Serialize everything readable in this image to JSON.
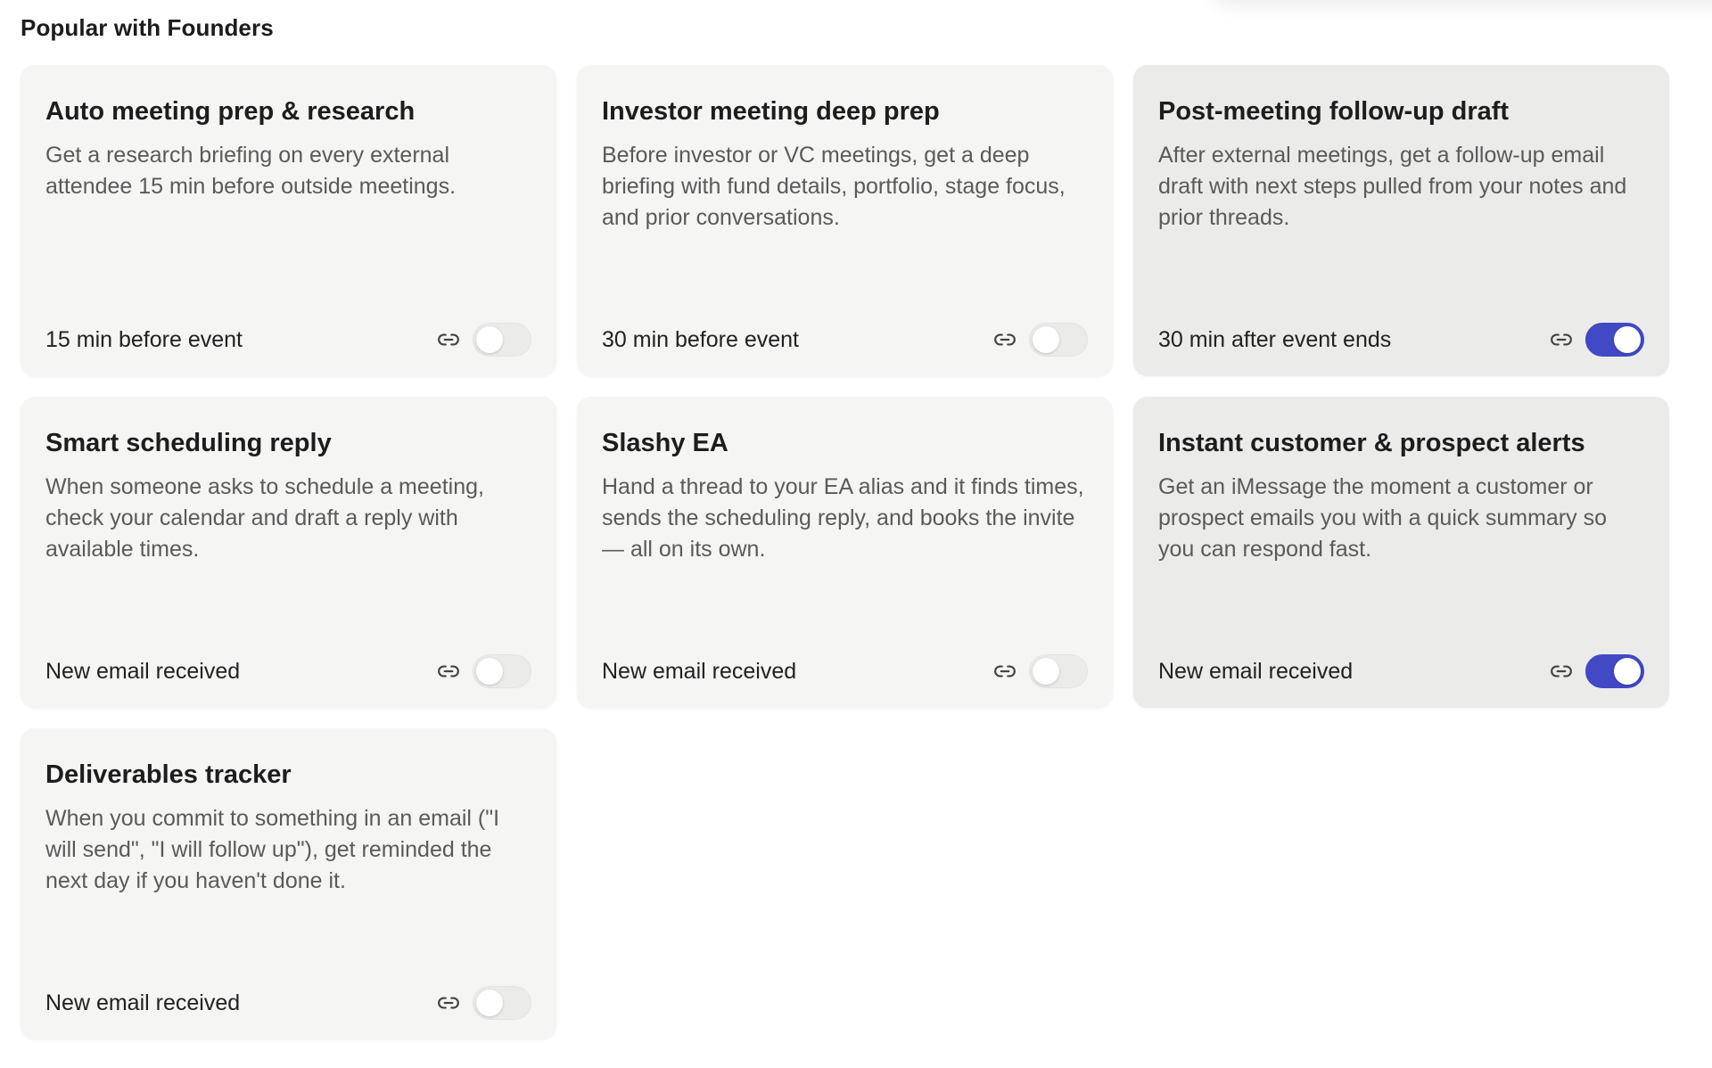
{
  "section": {
    "title": "Popular with Founders"
  },
  "colors": {
    "toggle_on": "#4149c4",
    "toggle_off": "#ebebea",
    "card_bg": "#f5f5f4",
    "card_active_bg": "#ebebea"
  },
  "cards": [
    {
      "title": "Auto meeting prep & research",
      "description": "Get a research briefing on every external attendee 15 min before outside meetings.",
      "trigger": "15 min before event",
      "icon": "link-icon",
      "enabled": false
    },
    {
      "title": "Investor meeting deep prep",
      "description": "Before investor or VC meetings, get a deep briefing with fund details, portfolio, stage focus, and prior conversations.",
      "trigger": "30 min before event",
      "icon": "link-icon",
      "enabled": false
    },
    {
      "title": "Post-meeting follow-up draft",
      "description": "After external meetings, get a follow-up email draft with next steps pulled from your notes and prior threads.",
      "trigger": "30 min after event ends",
      "icon": "link-icon",
      "enabled": true
    },
    {
      "title": "Smart scheduling reply",
      "description": "When someone asks to schedule a meeting, check your calendar and draft a reply with available times.",
      "trigger": "New email received",
      "icon": "link-icon",
      "enabled": false
    },
    {
      "title": "Slashy EA",
      "description": "Hand a thread to your EA alias and it finds times, sends the scheduling reply, and books the invite — all on its own.",
      "trigger": "New email received",
      "icon": "link-icon",
      "enabled": false
    },
    {
      "title": "Instant customer & prospect alerts",
      "description": "Get an iMessage the moment a customer or prospect emails you with a quick summary so you can respond fast.",
      "trigger": "New email received",
      "icon": "link-icon",
      "enabled": true
    },
    {
      "title": "Deliverables tracker",
      "description": "When you commit to something in an email (\"I will send\", \"I will follow up\"), get reminded the next day if you haven't done it.",
      "trigger": "New email received",
      "icon": "link-icon",
      "enabled": false
    }
  ]
}
